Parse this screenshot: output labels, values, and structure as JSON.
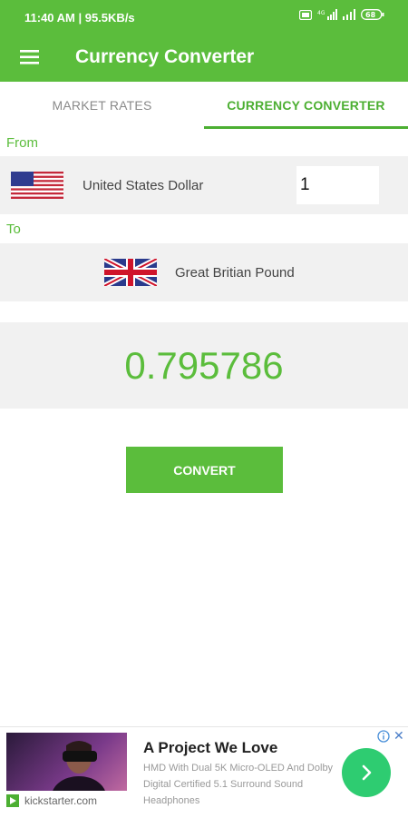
{
  "status_bar": {
    "time": "11:40 AM | 95.5KB/s",
    "battery": "68"
  },
  "toolbar": {
    "title": "Currency Converter",
    "menu_icon": "hamburger-menu-icon"
  },
  "tabs": [
    {
      "label": "MARKET RATES",
      "selected": false
    },
    {
      "label": "CURRENCY CONVERTER",
      "selected": true
    }
  ],
  "from": {
    "label": "From",
    "currency": "United States Dollar",
    "flag_icon": "us-flag-icon",
    "amount": "1"
  },
  "to": {
    "label": "To",
    "currency": "Great Britian Pound",
    "flag_icon": "uk-flag-icon"
  },
  "result": {
    "value": "0.795786"
  },
  "convert_button": {
    "label": "CONVERT"
  },
  "ad": {
    "title": "A Project We Love",
    "description": "HMD With Dual 5K Micro-OLED And Dolby Digital Certified 5.1 Surround Sound Headphones",
    "domain": "kickstarter.com",
    "close": "✕"
  },
  "colors": {
    "accent": "#5bbd3c",
    "tab_active": "#4caf32",
    "row_bg": "#f1f1f1",
    "ad_cta": "#2ecc71"
  }
}
